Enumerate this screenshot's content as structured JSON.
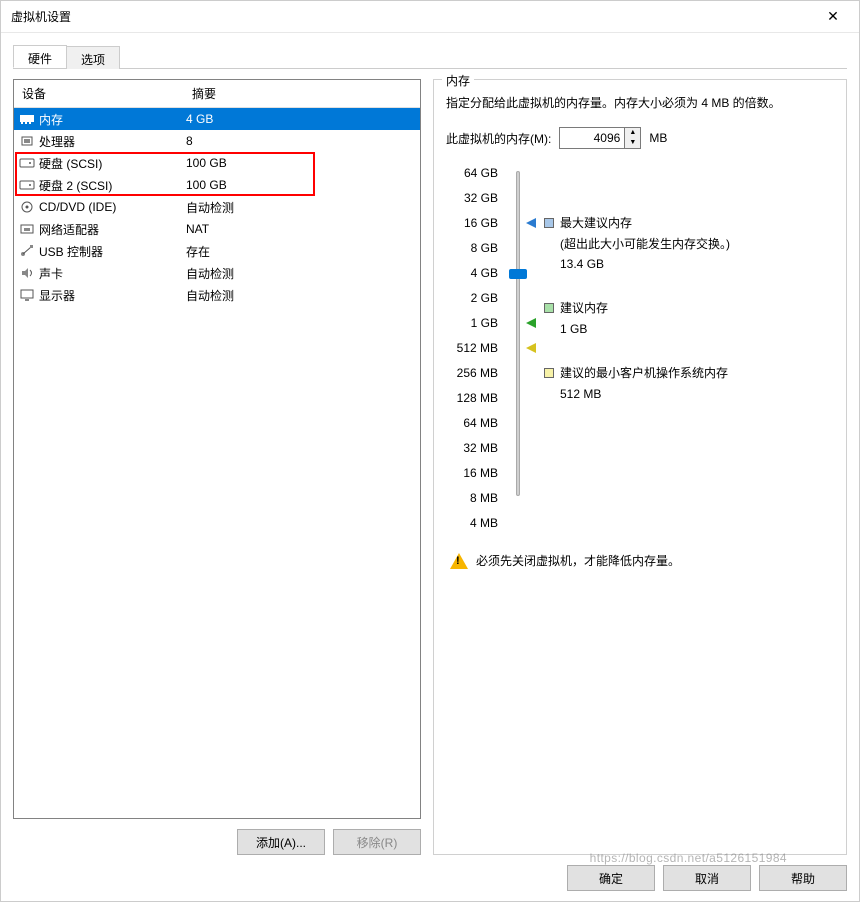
{
  "window": {
    "title": "虚拟机设置"
  },
  "tabs": {
    "hardware": "硬件",
    "options": "选项"
  },
  "list": {
    "headers": {
      "device": "设备",
      "summary": "摘要"
    },
    "rows": [
      {
        "icon": "memory-icon",
        "device": "内存",
        "summary": "4 GB",
        "selected": true
      },
      {
        "icon": "cpu-icon",
        "device": "处理器",
        "summary": "8"
      },
      {
        "icon": "disk-icon",
        "device": "硬盘 (SCSI)",
        "summary": "100 GB"
      },
      {
        "icon": "disk-icon",
        "device": "硬盘 2 (SCSI)",
        "summary": "100 GB"
      },
      {
        "icon": "cd-icon",
        "device": "CD/DVD (IDE)",
        "summary": "自动检测"
      },
      {
        "icon": "nic-icon",
        "device": "网络适配器",
        "summary": "NAT"
      },
      {
        "icon": "usb-icon",
        "device": "USB 控制器",
        "summary": "存在"
      },
      {
        "icon": "sound-icon",
        "device": "声卡",
        "summary": "自动检测"
      },
      {
        "icon": "display-icon",
        "device": "显示器",
        "summary": "自动检测"
      }
    ]
  },
  "buttons": {
    "add": "添加(A)...",
    "remove": "移除(R)",
    "ok": "确定",
    "cancel": "取消",
    "help": "帮助"
  },
  "memory": {
    "group_title": "内存",
    "desc": "指定分配给此虚拟机的内存量。内存大小必须为 4 MB 的倍数。",
    "label": "此虚拟机的内存(M):",
    "value": "4096",
    "unit": "MB",
    "ticks": [
      "64 GB",
      "32 GB",
      "16 GB",
      "8 GB",
      "4 GB",
      "2 GB",
      "1 GB",
      "512 MB",
      "256 MB",
      "128 MB",
      "64 MB",
      "32 MB",
      "16 MB",
      "8 MB",
      "4 MB"
    ],
    "legend": {
      "max_title": "最大建议内存",
      "max_note": "(超出此大小可能发生内存交换。)",
      "max_value": "13.4 GB",
      "rec_title": "建议内存",
      "rec_value": "1 GB",
      "min_title": "建议的最小客户机操作系统内存",
      "min_value": "512 MB"
    },
    "warning": "必须先关闭虚拟机，才能降低内存量。"
  },
  "watermark": "https://blog.csdn.net/a5126151984"
}
